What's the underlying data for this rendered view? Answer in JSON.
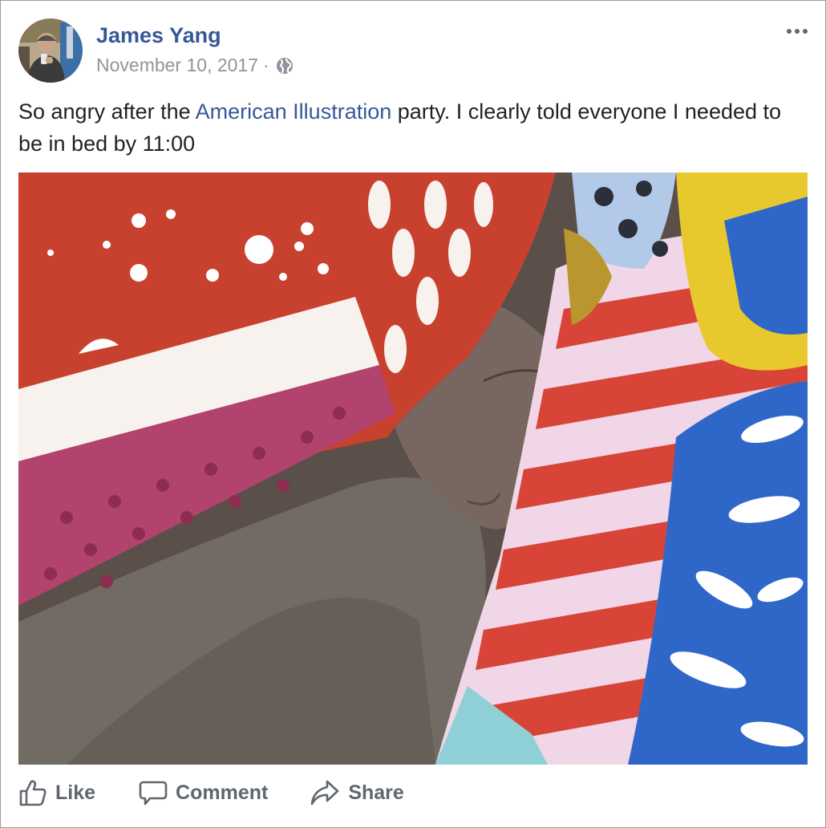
{
  "post": {
    "author": "James Yang",
    "date": "November 10, 2017",
    "separator": "·",
    "privacy_icon": "globe-icon",
    "menu_icon": "more-options-icon",
    "text_before_link": "So angry after the ",
    "link_text": "American Illustration",
    "text_after_link": " party. I clearly told everyone I needed to be in bed by 11:00"
  },
  "actions": {
    "like_label": "Like",
    "comment_label": "Comment",
    "share_label": "Share"
  },
  "colors": {
    "link": "#365899",
    "meta": "#90949c",
    "text": "#1d2129",
    "action": "#606770"
  }
}
